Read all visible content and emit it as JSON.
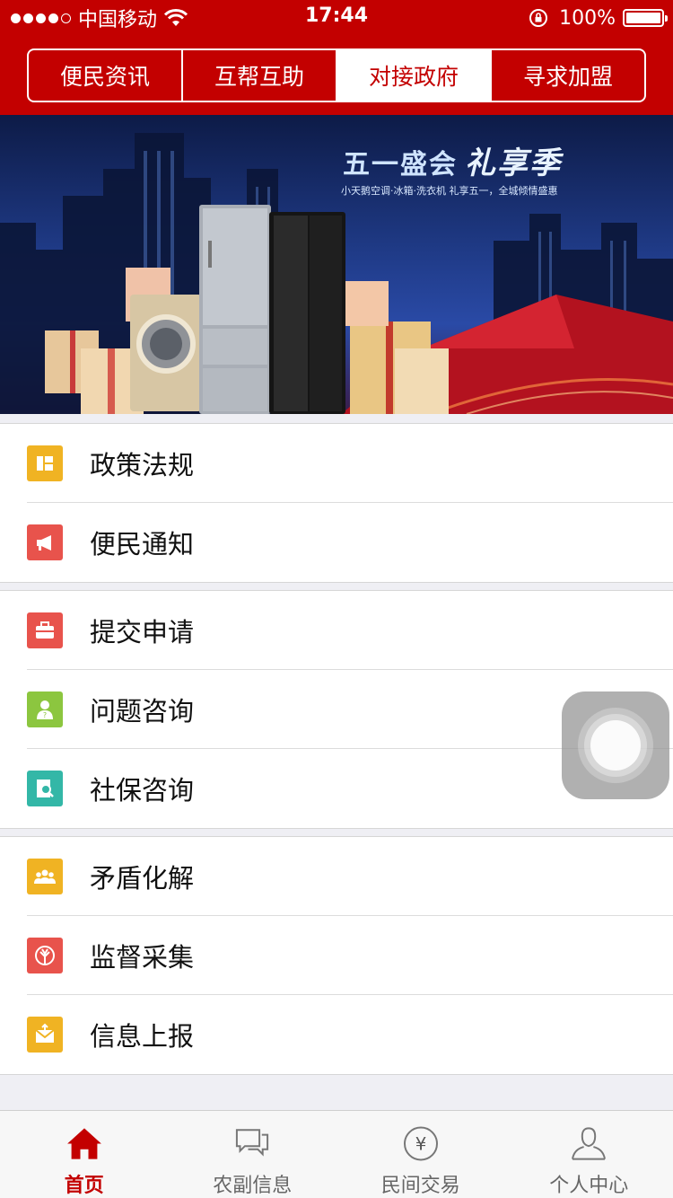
{
  "status_bar": {
    "carrier": "中国移动",
    "time": "17:44",
    "battery": "100%"
  },
  "segmented": {
    "tabs": [
      {
        "label": "便民资讯",
        "active": false
      },
      {
        "label": "互帮互助",
        "active": false
      },
      {
        "label": "对接政府",
        "active": true
      },
      {
        "label": "寻求加盟",
        "active": false
      }
    ]
  },
  "banner": {
    "title": "五一盛会",
    "title_em": "礼享季",
    "subtitle": "小天鹅空调·冰箱·洗衣机 礼享五一，全城倾情盛惠"
  },
  "groups": [
    {
      "items": [
        {
          "label": "政策法规",
          "icon": "policy-icon",
          "color": "#f0b323"
        },
        {
          "label": "便民通知",
          "icon": "megaphone-icon",
          "color": "#e8534c"
        }
      ]
    },
    {
      "items": [
        {
          "label": "提交申请",
          "icon": "briefcase-icon",
          "color": "#e8534c"
        },
        {
          "label": "问题咨询",
          "icon": "question-user-icon",
          "color": "#8cc63f"
        },
        {
          "label": "社保咨询",
          "icon": "search-document-icon",
          "color": "#33b7a7"
        }
      ]
    },
    {
      "items": [
        {
          "label": "矛盾化解",
          "icon": "group-icon",
          "color": "#f0b323"
        },
        {
          "label": "监督采集",
          "icon": "tree-icon",
          "color": "#e8534c"
        },
        {
          "label": "信息上报",
          "icon": "mail-icon",
          "color": "#f0b323"
        }
      ]
    }
  ],
  "tabbar": {
    "tabs": [
      {
        "label": "首页",
        "icon": "home-icon",
        "active": true
      },
      {
        "label": "农副信息",
        "icon": "chat-icon",
        "active": false
      },
      {
        "label": "民间交易",
        "icon": "yuan-icon",
        "active": false
      },
      {
        "label": "个人中心",
        "icon": "user-icon",
        "active": false
      }
    ]
  },
  "colors": {
    "brand_red": "#c30000",
    "list_bg": "#efeff4"
  }
}
